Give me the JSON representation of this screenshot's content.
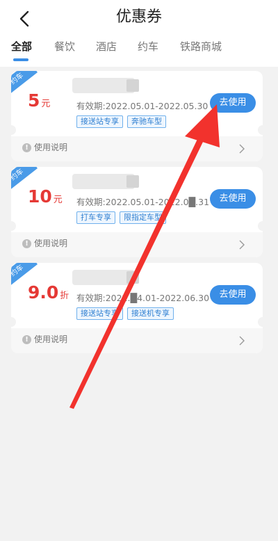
{
  "header": {
    "title": "优惠券",
    "tabs": [
      "全部",
      "餐饮",
      "酒店",
      "约车",
      "铁路商城"
    ]
  },
  "coupons": [
    {
      "tag": "约车",
      "amount": "5",
      "unit": "元",
      "validity": "有效期:2022.05.01-2022.05.30",
      "chips": [
        "接送站专享",
        "奔驰车型"
      ],
      "button": "去使用",
      "info": "使用说明"
    },
    {
      "tag": "约车",
      "amount": "10",
      "unit": "元",
      "validity": "有效期:2022.05.01-2022.0█.31",
      "chips": [
        "打车专享",
        "限指定车型"
      ],
      "button": "去使用",
      "info": "使用说明"
    },
    {
      "tag": "约车",
      "amount": "9.0",
      "unit": "折",
      "validity": "有效期:2022.█4.01-2022.06.30",
      "chips": [
        "接送站专享",
        "接送机专享"
      ],
      "button": "去使用",
      "info": "使用说明"
    }
  ],
  "colors": {
    "accent": "#3a8ee6",
    "price": "#e53935",
    "annotation_arrow": "#f2322d"
  }
}
